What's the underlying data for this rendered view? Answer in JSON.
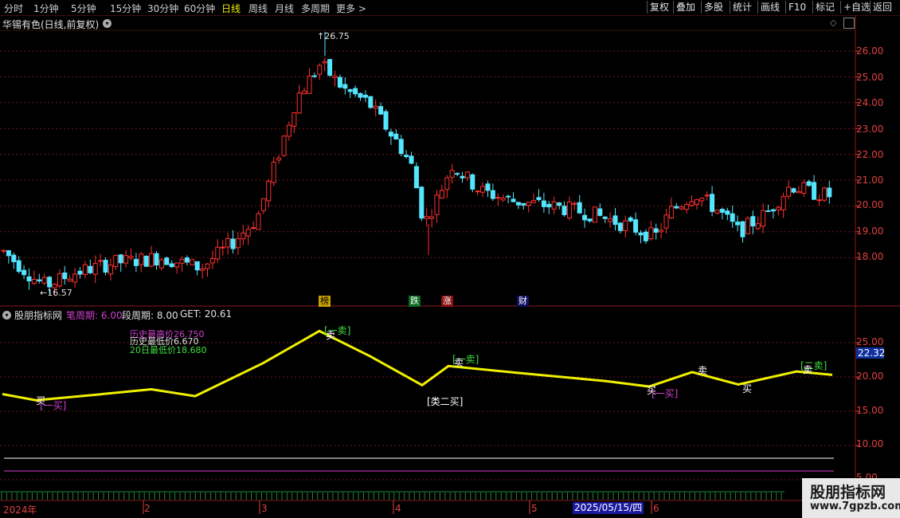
{
  "toolbar": {
    "timeframes": [
      "分时",
      "1分钟",
      "5分钟",
      "15分钟",
      "30分钟",
      "60分钟",
      "日线",
      "周线",
      "月线",
      "多周期",
      "更多 >"
    ],
    "active": "日线",
    "right_buttons": [
      "复权",
      "叠加",
      "多股",
      "统计",
      "画线",
      "F10",
      "标记",
      "+自选",
      "返回"
    ]
  },
  "main_chart": {
    "title": "华锡有色(日线,前复权)",
    "high_label": "26.75",
    "low_label": "16.57",
    "price_axis": [
      "26.00",
      "25.00",
      "24.00",
      "23.00",
      "22.00",
      "21.00",
      "20.00",
      "19.00",
      "18.00"
    ],
    "event_markers": [
      {
        "text": "榜",
        "bg": "#c8a000",
        "color": "#000"
      },
      {
        "text": "跌",
        "bg": "#0a6a20",
        "color": "#fff"
      },
      {
        "text": "涨",
        "bg": "#8a1010",
        "color": "#fff"
      },
      {
        "text": "财",
        "bg": "#101060",
        "color": "#fff"
      }
    ],
    "colors": {
      "up": "#ff3030",
      "down": "#54e6ff",
      "grid": "#6a1818",
      "axis_text": "#e04040"
    }
  },
  "indicator": {
    "name": "股朋指标网",
    "params": [
      {
        "label": "笔周期:",
        "value": "6.00",
        "color": "#d040d0"
      },
      {
        "label": "段周期:",
        "value": "8.00",
        "color": "#e0e0e0"
      },
      {
        "label": "GET:",
        "value": "20.61",
        "color": "#e0e0e0"
      }
    ],
    "info_lines": [
      {
        "text": "历史最高价26.750",
        "color": "#d040d0"
      },
      {
        "text": "历史最低价6.670",
        "color": "#e0e0e0"
      },
      {
        "text": "20日最低价18.680",
        "color": "#40e040"
      }
    ],
    "axis": [
      "25.00",
      "20.00",
      "15.00",
      "10.00",
      "5.00"
    ],
    "current_value": "22.32",
    "signals": [
      {
        "text": "买",
        "color": "#ffffff"
      },
      {
        "text": "[一买]",
        "color": "#d040d0"
      },
      {
        "text": "[一卖]",
        "color": "#40e040"
      },
      {
        "text": "卖",
        "color": "#ffffff"
      },
      {
        "text": "[类二买]",
        "color": "#ffffff"
      },
      {
        "text": "[一卖]",
        "color": "#40e040"
      },
      {
        "text": "卖",
        "color": "#ffffff"
      },
      {
        "text": "买",
        "color": "#ffffff"
      },
      {
        "text": "[一买]",
        "color": "#d040d0"
      },
      {
        "text": "卖",
        "color": "#ffffff"
      },
      {
        "text": "买",
        "color": "#ffffff"
      },
      {
        "text": "[二卖]",
        "color": "#40e040"
      },
      {
        "text": "卖",
        "color": "#ffffff"
      }
    ],
    "line_color": "#f0f000"
  },
  "date_axis": {
    "labels": [
      "2024年",
      "2",
      "3",
      "4",
      "5",
      "6"
    ],
    "cursor_date": "2025/05/15/四"
  },
  "watermark": {
    "title": "股朋指标网",
    "url": "www.7gpzb.com"
  }
}
